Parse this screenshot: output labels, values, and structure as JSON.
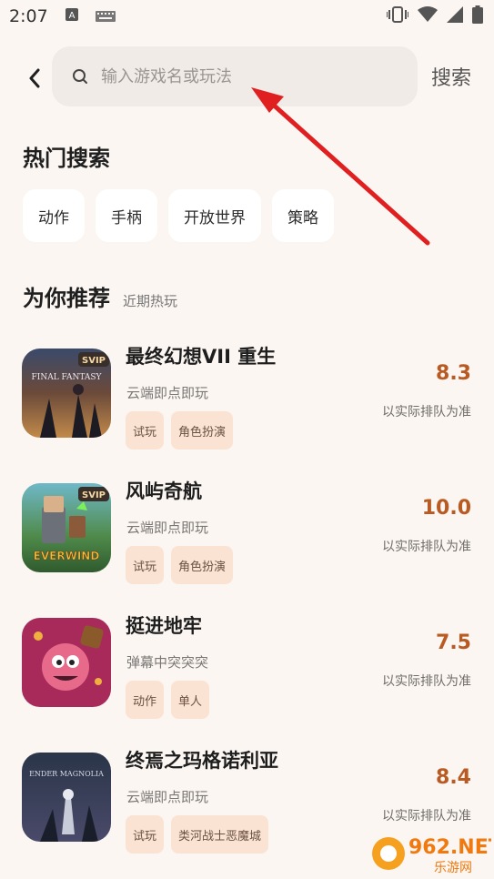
{
  "status_bar": {
    "time": "2:07"
  },
  "search": {
    "placeholder": "输入游戏名或玩法",
    "button_label": "搜索"
  },
  "hot_search": {
    "title": "热门搜索",
    "chips": [
      "动作",
      "手柄",
      "开放世界",
      "策略"
    ]
  },
  "recommend": {
    "title": "为你推荐",
    "subtitle": "近期热玩",
    "games": [
      {
        "name": "最终幻想VII 重生",
        "desc": "云端即点即玩",
        "tags": [
          "试玩",
          "角色扮演"
        ],
        "score": "8.3",
        "queue_note": "以实际排队为准",
        "badge": "SVIP",
        "icon_text": "FINAL FANTASY"
      },
      {
        "name": "风屿奇航",
        "desc": "云端即点即玩",
        "tags": [
          "试玩",
          "角色扮演"
        ],
        "score": "10.0",
        "queue_note": "以实际排队为准",
        "badge": "SVIP",
        "icon_text": "EVERWIND"
      },
      {
        "name": "挺进地牢",
        "desc": "弹幕中突突突",
        "tags": [
          "动作",
          "单人"
        ],
        "score": "7.5",
        "queue_note": "以实际排队为准"
      },
      {
        "name": "终焉之玛格诺利亚",
        "desc": "云端即点即玩",
        "tags": [
          "试玩",
          "类河战士恶魔城"
        ],
        "score": "8.4",
        "queue_note": "以实际排队为准",
        "icon_text": "ENDER MAGNOLIA"
      }
    ]
  },
  "watermark": {
    "brand": "962.NET",
    "sub": "乐游网"
  },
  "colors": {
    "background": "#fbf6f2",
    "accent": "#b85a22",
    "tag_bg": "#fbe3d3",
    "arrow": "#e02020"
  }
}
